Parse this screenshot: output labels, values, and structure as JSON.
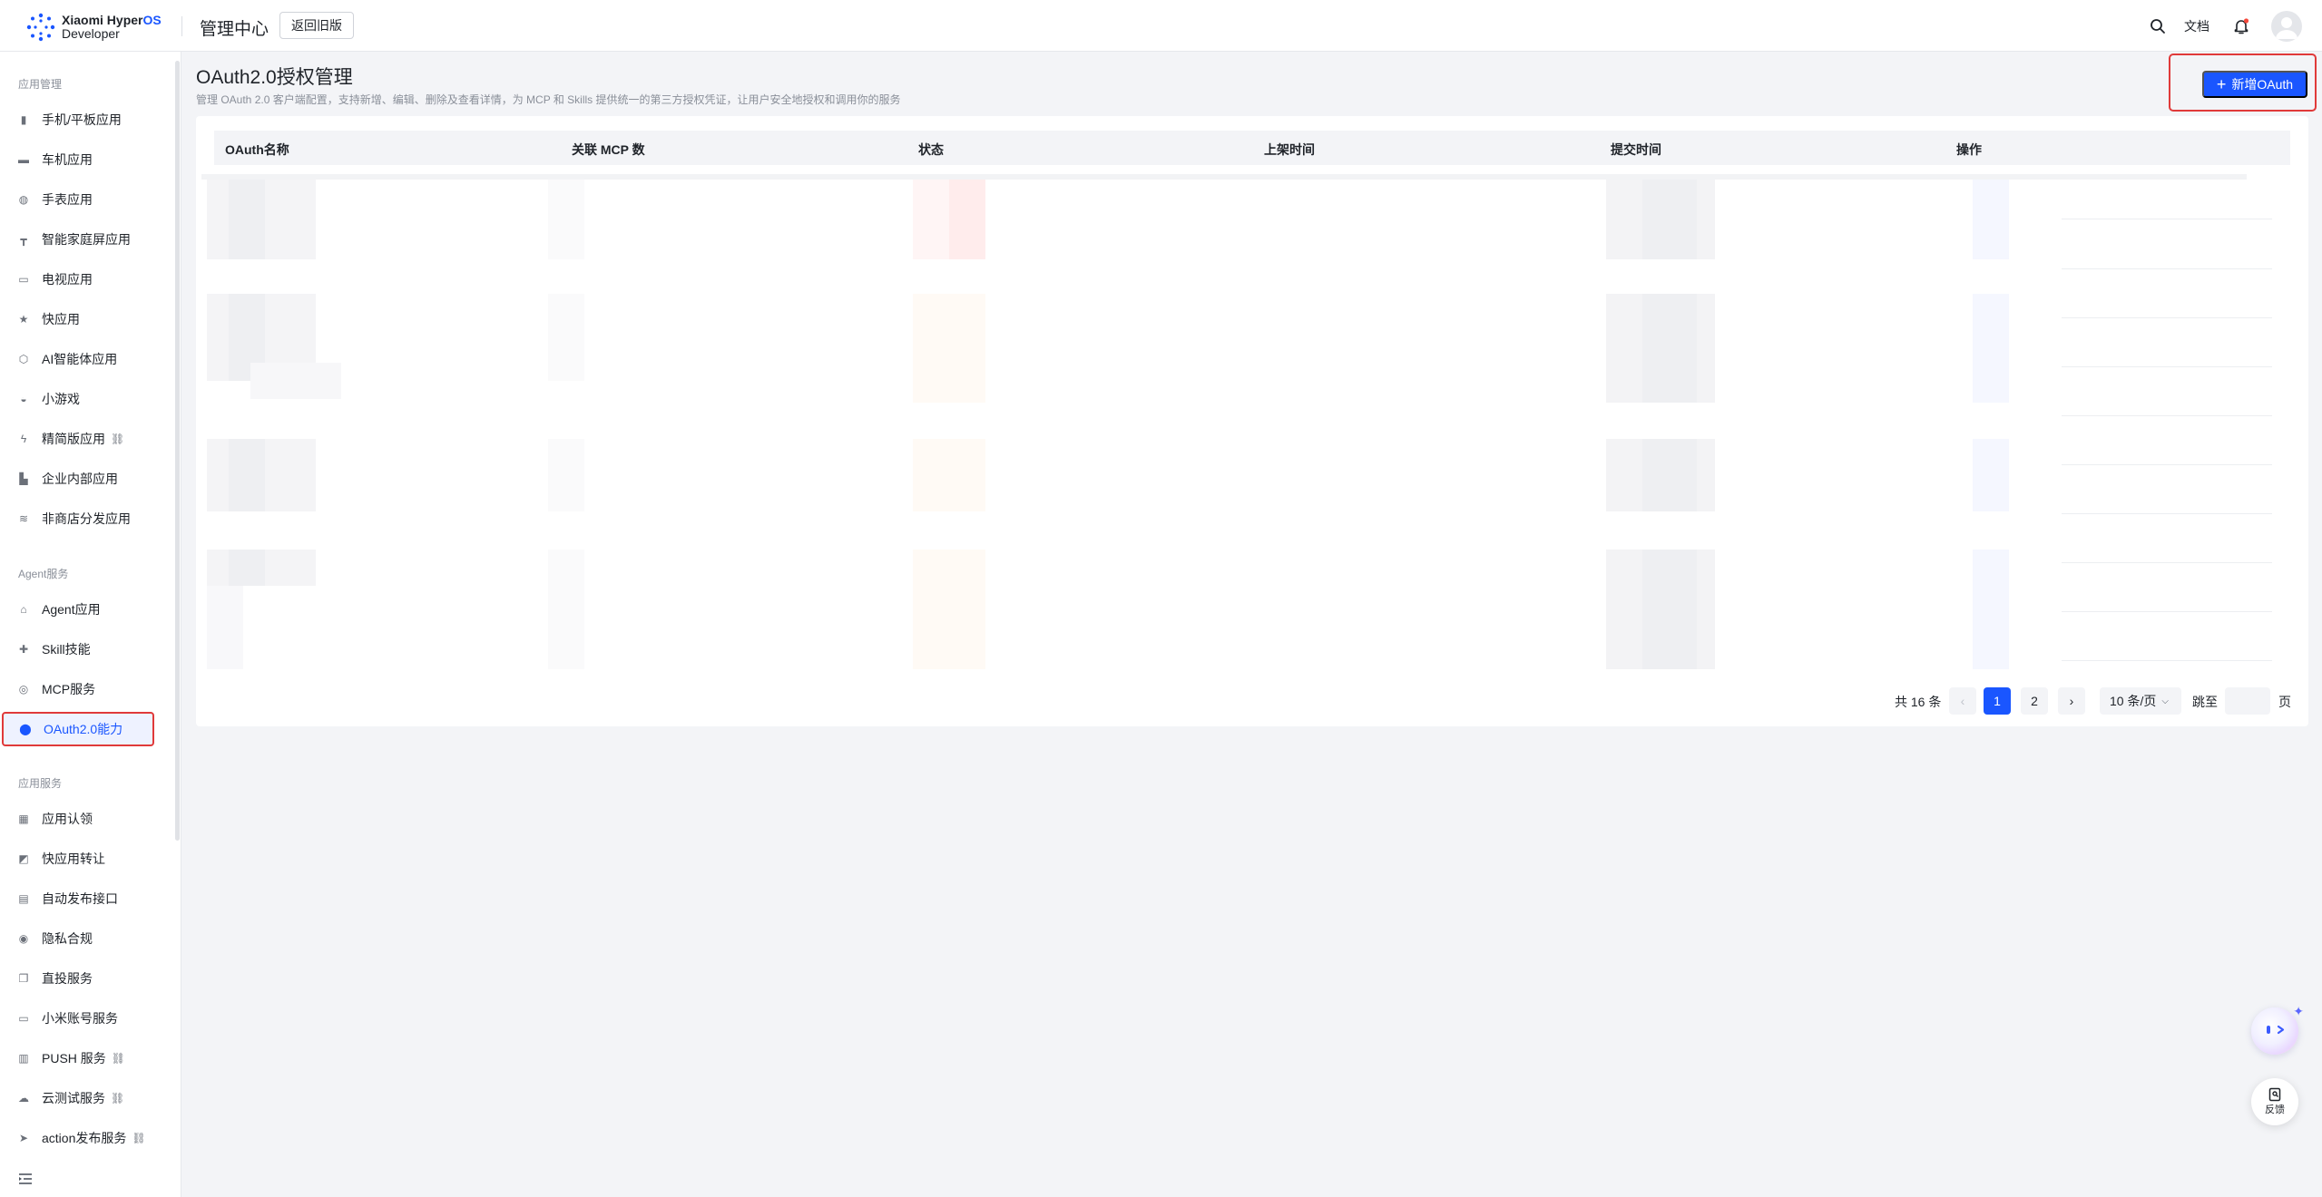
{
  "header": {
    "logo_line1_a": "Xiaomi Hyper",
    "logo_line1_b": "OS",
    "logo_line2": "Developer",
    "title": "管理中心",
    "old_version_label": "返回旧版",
    "doc_label": "文档",
    "icons": [
      "search-icon",
      "bell-icon",
      "avatar"
    ]
  },
  "sidebar": {
    "groups": [
      {
        "label": "应用管理",
        "items": [
          {
            "label": "手机/平板应用",
            "icon": "phone-icon"
          },
          {
            "label": "车机应用",
            "icon": "car-icon"
          },
          {
            "label": "手表应用",
            "icon": "watch-icon"
          },
          {
            "label": "智能家庭屏应用",
            "icon": "home-screen-icon"
          },
          {
            "label": "电视应用",
            "icon": "tv-icon"
          },
          {
            "label": "快应用",
            "icon": "star-icon"
          },
          {
            "label": "AI智能体应用",
            "icon": "ai-cube-icon"
          },
          {
            "label": "小游戏",
            "icon": "gamepad-icon"
          },
          {
            "label": "精简版应用",
            "icon": "lightning-icon",
            "external": true
          },
          {
            "label": "企业内部应用",
            "icon": "building-icon"
          },
          {
            "label": "非商店分发应用",
            "icon": "layers-icon"
          }
        ]
      },
      {
        "label": "Agent服务",
        "items": [
          {
            "label": "Agent应用",
            "icon": "robot-icon"
          },
          {
            "label": "Skill技能",
            "icon": "puzzle-icon"
          },
          {
            "label": "MCP服务",
            "icon": "mcp-icon"
          },
          {
            "label": "OAuth2.0能力",
            "icon": "shield-icon",
            "active": true
          }
        ]
      },
      {
        "label": "应用服务",
        "items": [
          {
            "label": "应用认领",
            "icon": "grid-icon"
          },
          {
            "label": "快应用转让",
            "icon": "transfer-icon"
          },
          {
            "label": "自动发布接口",
            "icon": "api-icon"
          },
          {
            "label": "隐私合规",
            "icon": "privacy-icon"
          },
          {
            "label": "直投服务",
            "icon": "copy-icon"
          },
          {
            "label": "小米账号服务",
            "icon": "account-icon"
          },
          {
            "label": "PUSH 服务",
            "icon": "push-icon",
            "external": true
          },
          {
            "label": "云测试服务",
            "icon": "cloud-icon",
            "external": true
          },
          {
            "label": "action发布服务",
            "icon": "send-icon",
            "external": true
          }
        ]
      }
    ]
  },
  "main": {
    "title": "OAuth2.0授权管理",
    "description": "管理 OAuth 2.0 客户端配置，支持新增、编辑、删除及查看详情，为 MCP 和 Skills 提供统一的第三方授权凭证，让用户安全地授权和调用你的服务",
    "add_button_label": "新增OAuth",
    "table": {
      "columns": [
        "OAuth名称",
        "关联 MCP 数",
        "状态",
        "上架时间",
        "提交时间",
        "操作"
      ]
    },
    "pagination": {
      "total_label": "共 16 条",
      "prev": "‹",
      "pages": [
        "1",
        "2"
      ],
      "current": "1",
      "next": "›",
      "page_size": "10 条/页",
      "jump_label": "跳至",
      "jump_value": "",
      "page_unit": "页"
    }
  },
  "floating": {
    "feedback_label": "反馈"
  },
  "colors": {
    "accent": "#1a56ff",
    "highlight_border": "#e03a3a",
    "page_bg": "#f3f4f7"
  }
}
